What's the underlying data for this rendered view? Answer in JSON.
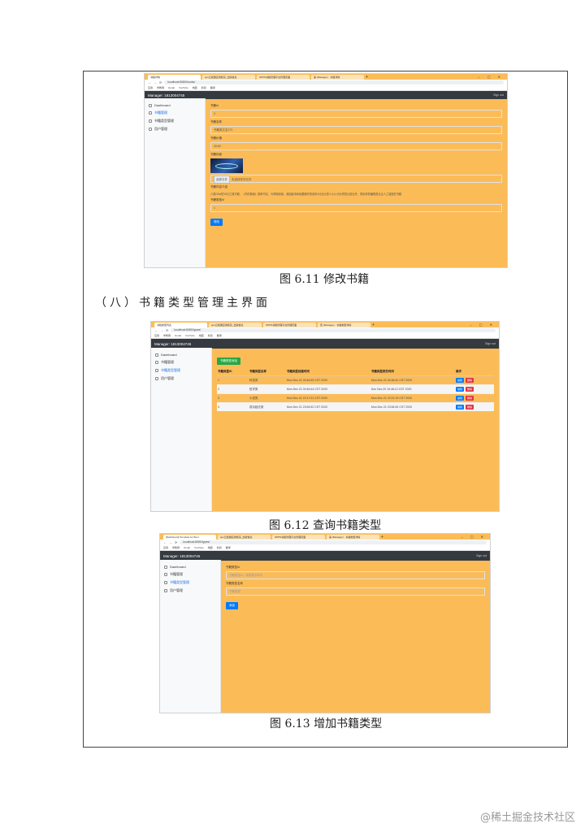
{
  "screenshots": {
    "edit_book": {
      "tabs": [
        "书籍详情",
        "spu云拓展应用核实_出版信息",
        "SPPN书籍管理平台管理页面",
        "第 (Manager) · 书籍详情"
      ],
      "url": "localhost:8080/books/",
      "bookmarks": [
        "应用",
        "学教网",
        "Gmail",
        "YouTube",
        "地图",
        "新闻",
        "翻译"
      ],
      "manager_label": "Manager:",
      "manager_id": "1813004745",
      "sign_out": "Sign out",
      "sidebar": [
        "Dashboard",
        "书籍管理",
        "书籍类型管理",
        "用户管理"
      ],
      "fields": {
        "id_label": "书籍id",
        "id_value": "3",
        "name_label": "书籍名称",
        "name_value": "书籍英文名272",
        "price_label": "书籍价格",
        "price_value": "28.80",
        "cover_label": "书籍封面",
        "file_button": "选择文件",
        "file_status": "未选择任何文件",
        "desc_label": "书籍内容介绍",
        "desc_value": "人类DNA的15分之原书籍，《书的奥秘》推荐书目，与神相领域，我因最本和经要都作的资料4分应大的人士以识大的的比较业外，规则事的编程类业企人工智能的书籍",
        "type_label": "书籍类型id",
        "type_value": "1"
      },
      "submit": "修改"
    },
    "list_types": {
      "tabs": [
        "书籍类型列表",
        "spu云拓展应用核实_出版信息",
        "SPPN书籍管理平台管理页面",
        "查 (Manager) · 书籍类型详情"
      ],
      "url": "localhost:8080/types/",
      "bookmarks": [
        "应用",
        "学教网",
        "Gmail",
        "YouTube",
        "地图",
        "新闻",
        "翻译"
      ],
      "manager_label": "Manager:",
      "manager_id": "1813004745",
      "sign_out": "Sign out",
      "sidebar": [
        "Dashboard",
        "书籍管理",
        "书籍类型管理",
        "用户管理"
      ],
      "add_button": "书籍类型添加",
      "columns": [
        "书籍类型ID",
        "书籍类型名称",
        "书籍类型创建时间",
        "书籍类型更改时间",
        "操作"
      ],
      "rows": [
        [
          "1",
          "科技类",
          "Mon Dec 21 00:46:39 CST 2020",
          "Mon Dec 21 00:46:42 CST 2020"
        ],
        [
          "2",
          "哲学类",
          "Mon Dec 21 00:46:44 CST 2020",
          "Sun Dec 20 10:46:12 CST 2020"
        ],
        [
          "3",
          "小说类",
          "Mon Dec 21 22:17:21 CST 2020",
          "Mon Dec 21 22:21:19 CST 2020"
        ],
        [
          "4",
          "成功励志类",
          "Mon Dec 21 23:54:52 CST 2020",
          "Mon Dec 21 23:54:52 CST 2020"
        ]
      ],
      "edit_label": "编辑",
      "delete_label": "删除"
    },
    "add_type": {
      "tabs": [
        "[Dashboard] Template for Boot",
        "spu云拓展应用核实_出版信息",
        "SPPN书籍管理平台管理页面",
        "第 (Manager) · 书籍类型详情"
      ],
      "url": "localhost:8080/types/",
      "bookmarks": [
        "应用",
        "学教网",
        "Gmail",
        "YouTube",
        "地图",
        "新闻",
        "翻译"
      ],
      "manager_label": "Manager:",
      "manager_id": "1813004745",
      "sign_out": "Sign out",
      "sidebar": [
        "Dashboard",
        "书籍管理",
        "书籍类型管理",
        "用户管理"
      ],
      "id_label": "书籍类型id",
      "id_placeholder": "书籍类型id，请按数字填写",
      "name_label": "书籍类型名称",
      "name_placeholder": "书籍类型",
      "submit": "添加"
    }
  },
  "captions": {
    "fig_6_11": "图 6.11  修改书籍",
    "section_8": "（八）书籍类型管理主界面",
    "fig_6_12": "图 6.12 查询书籍类型",
    "fig_6_13": "图 6.13 增加书籍类型"
  },
  "watermark": "@稀土掘金技术社区"
}
